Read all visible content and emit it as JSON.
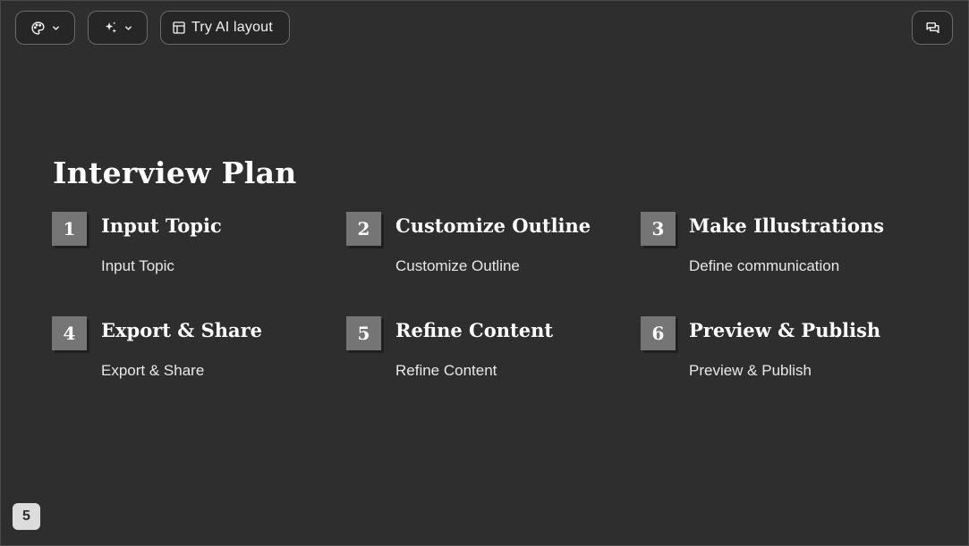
{
  "toolbar": {
    "theme_icon": "palette-icon",
    "ai_icon": "sparkles-icon",
    "layout_icon": "layout-icon",
    "layout_label": "Try AI layout",
    "chat_icon": "comments-icon"
  },
  "slide": {
    "title": "Interview Plan",
    "steps": [
      {
        "number": "1",
        "title": "Input Topic",
        "description": "Input Topic"
      },
      {
        "number": "2",
        "title": "Customize Outline",
        "description": "Customize Outline"
      },
      {
        "number": "3",
        "title": "Make Illustrations",
        "description": "Define communication"
      },
      {
        "number": "4",
        "title": "Export & Share",
        "description": "Export & Share"
      },
      {
        "number": "5",
        "title": "Refine Content",
        "description": "Refine Content"
      },
      {
        "number": "6",
        "title": "Preview & Publish",
        "description": "Preview & Publish"
      }
    ]
  },
  "page_number": "5",
  "colors": {
    "background": "#2e2e2e",
    "number_box": "#757575",
    "text": "#ffffff"
  }
}
